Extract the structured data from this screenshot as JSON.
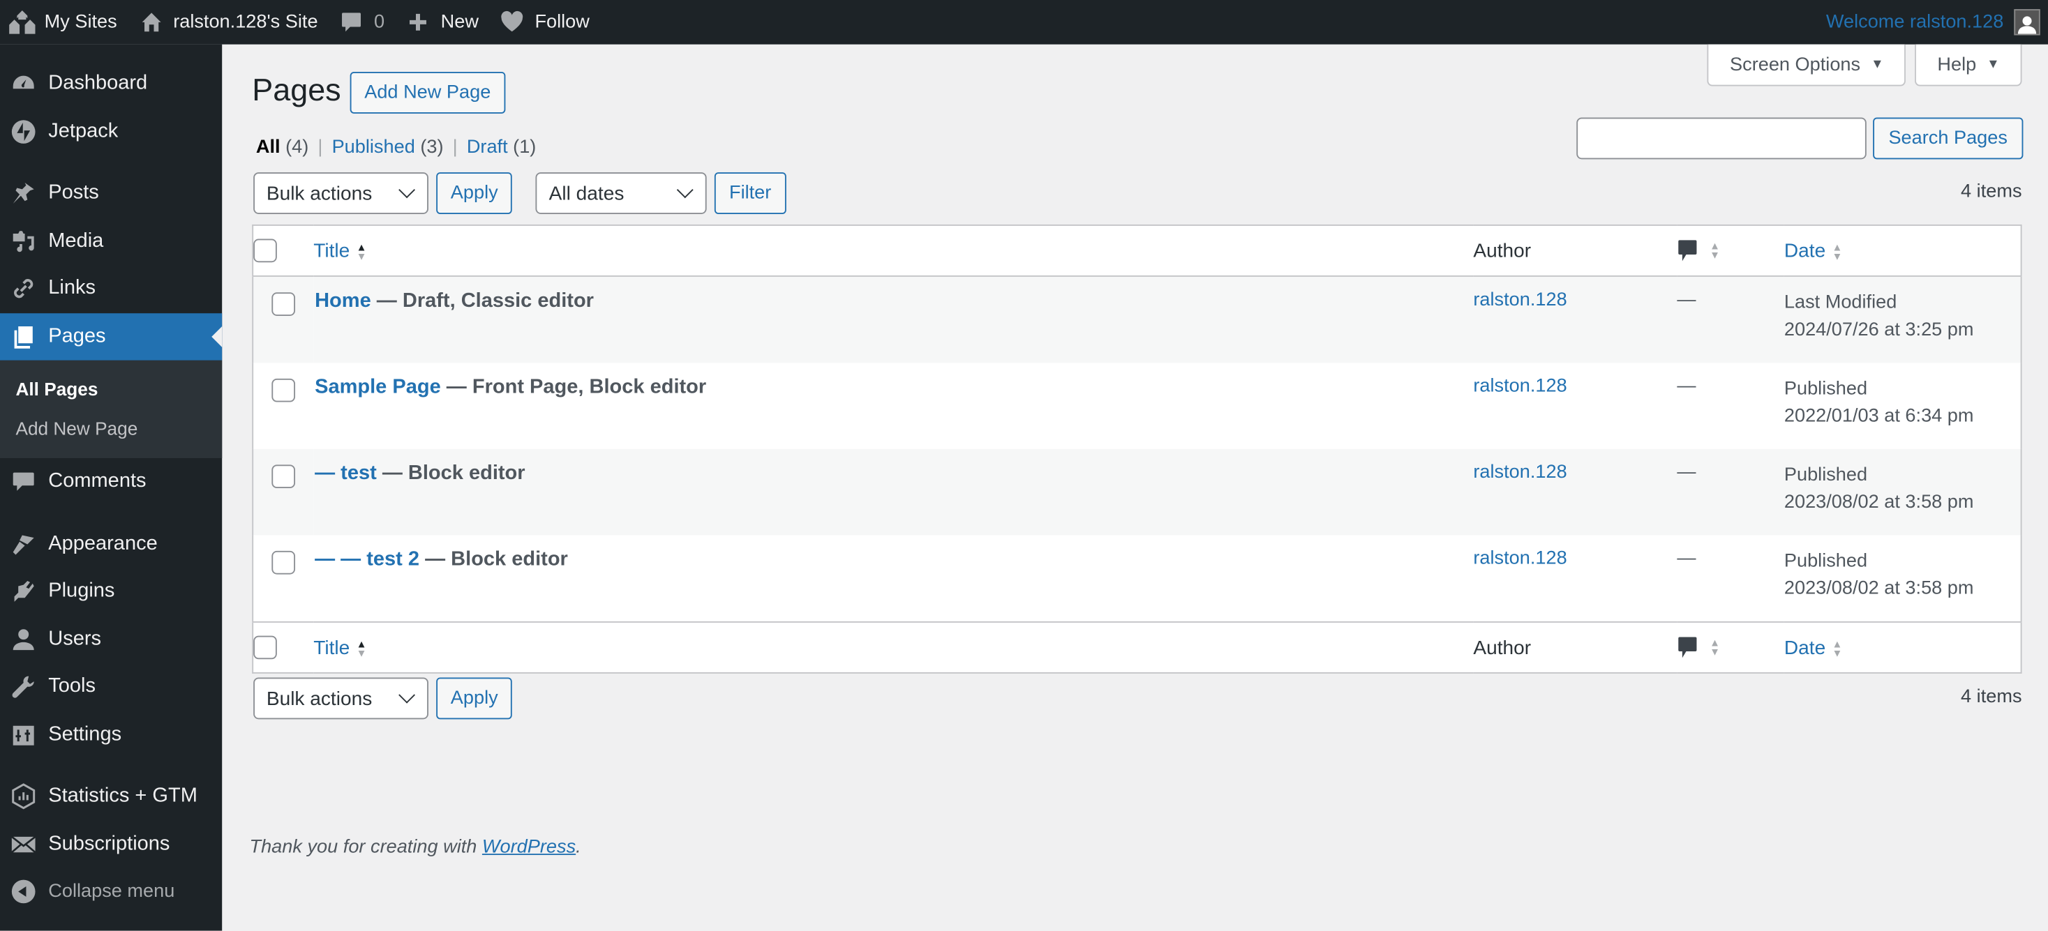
{
  "adminbar": {
    "my_sites": "My Sites",
    "site_name": "ralston.128's Site",
    "comments_count": "0",
    "new_label": "New",
    "follow_label": "Follow",
    "welcome": "Welcome ralston.128"
  },
  "sidebar": {
    "items": [
      {
        "label": "Dashboard",
        "icon": "dashboard-icon"
      },
      {
        "label": "Jetpack",
        "icon": "jetpack-icon"
      },
      {
        "label": "Posts",
        "icon": "pin-icon"
      },
      {
        "label": "Media",
        "icon": "media-icon"
      },
      {
        "label": "Links",
        "icon": "link-icon"
      },
      {
        "label": "Pages",
        "icon": "pages-icon"
      },
      {
        "label": "Comments",
        "icon": "comment-icon"
      },
      {
        "label": "Appearance",
        "icon": "brush-icon"
      },
      {
        "label": "Plugins",
        "icon": "plugin-icon"
      },
      {
        "label": "Users",
        "icon": "user-icon"
      },
      {
        "label": "Tools",
        "icon": "wrench-icon"
      },
      {
        "label": "Settings",
        "icon": "settings-icon"
      },
      {
        "label": "Statistics + GTM",
        "icon": "statistics-icon"
      },
      {
        "label": "Subscriptions",
        "icon": "envelope-icon"
      }
    ],
    "submenu": [
      "All Pages",
      "Add New Page"
    ],
    "collapse": "Collapse menu"
  },
  "screen_meta": {
    "screen_options": "Screen Options",
    "help": "Help"
  },
  "page": {
    "title": "Pages",
    "add_new": "Add New Page",
    "views": [
      {
        "label": "All",
        "count": "(4)"
      },
      {
        "label": "Published",
        "count": "(3)"
      },
      {
        "label": "Draft",
        "count": "(1)"
      }
    ],
    "search_value": "",
    "search_button": "Search Pages",
    "bulk_actions": "Bulk actions",
    "apply": "Apply",
    "dates": "All dates",
    "filter": "Filter",
    "items_count": "4 items"
  },
  "table": {
    "headers": {
      "title": "Title",
      "author": "Author",
      "date": "Date"
    },
    "rows": [
      {
        "title": "Home",
        "state": " — Draft, Classic editor",
        "author": "ralston.128",
        "comments": "—",
        "date_status": "Last Modified",
        "date": "2024/07/26 at 3:25 pm"
      },
      {
        "title": "Sample Page",
        "state": " — Front Page, Block editor",
        "author": "ralston.128",
        "comments": "—",
        "date_status": "Published",
        "date": "2022/01/03 at 6:34 pm"
      },
      {
        "title": "— test",
        "state": " — Block editor",
        "author": "ralston.128",
        "comments": "—",
        "date_status": "Published",
        "date": "2023/08/02 at 3:58 pm"
      },
      {
        "title": "— — test 2",
        "state": " — Block editor",
        "author": "ralston.128",
        "comments": "—",
        "date_status": "Published",
        "date": "2023/08/02 at 3:58 pm"
      }
    ]
  },
  "footer": {
    "text": "Thank you for creating with ",
    "link": "WordPress",
    "period": "."
  }
}
